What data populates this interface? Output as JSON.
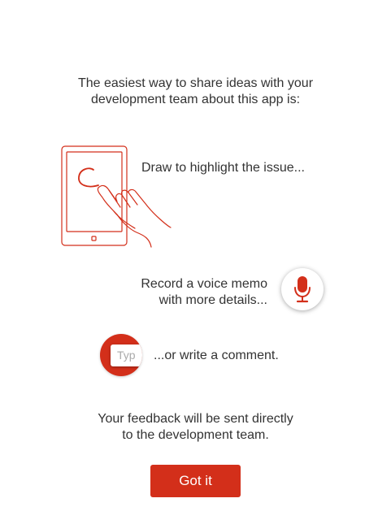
{
  "intro": {
    "line1": "The easiest way to share ideas with your",
    "line2": "development team about this app is:"
  },
  "draw": {
    "label": "Draw to highlight the issue...",
    "icon": "tablet-hand-drawing-icon"
  },
  "voice": {
    "line1": "Record a voice memo",
    "line2": "with more details...",
    "icon": "microphone-icon"
  },
  "comment": {
    "label": "...or write a comment.",
    "field_text": "Typ",
    "icon": "text-field-icon"
  },
  "footer": {
    "line1": "Your feedback will be sent directly",
    "line2": "to the development team."
  },
  "actions": {
    "got_it": "Got it"
  },
  "colors": {
    "accent": "#d32f1a",
    "text": "#333333",
    "background": "#ffffff"
  }
}
